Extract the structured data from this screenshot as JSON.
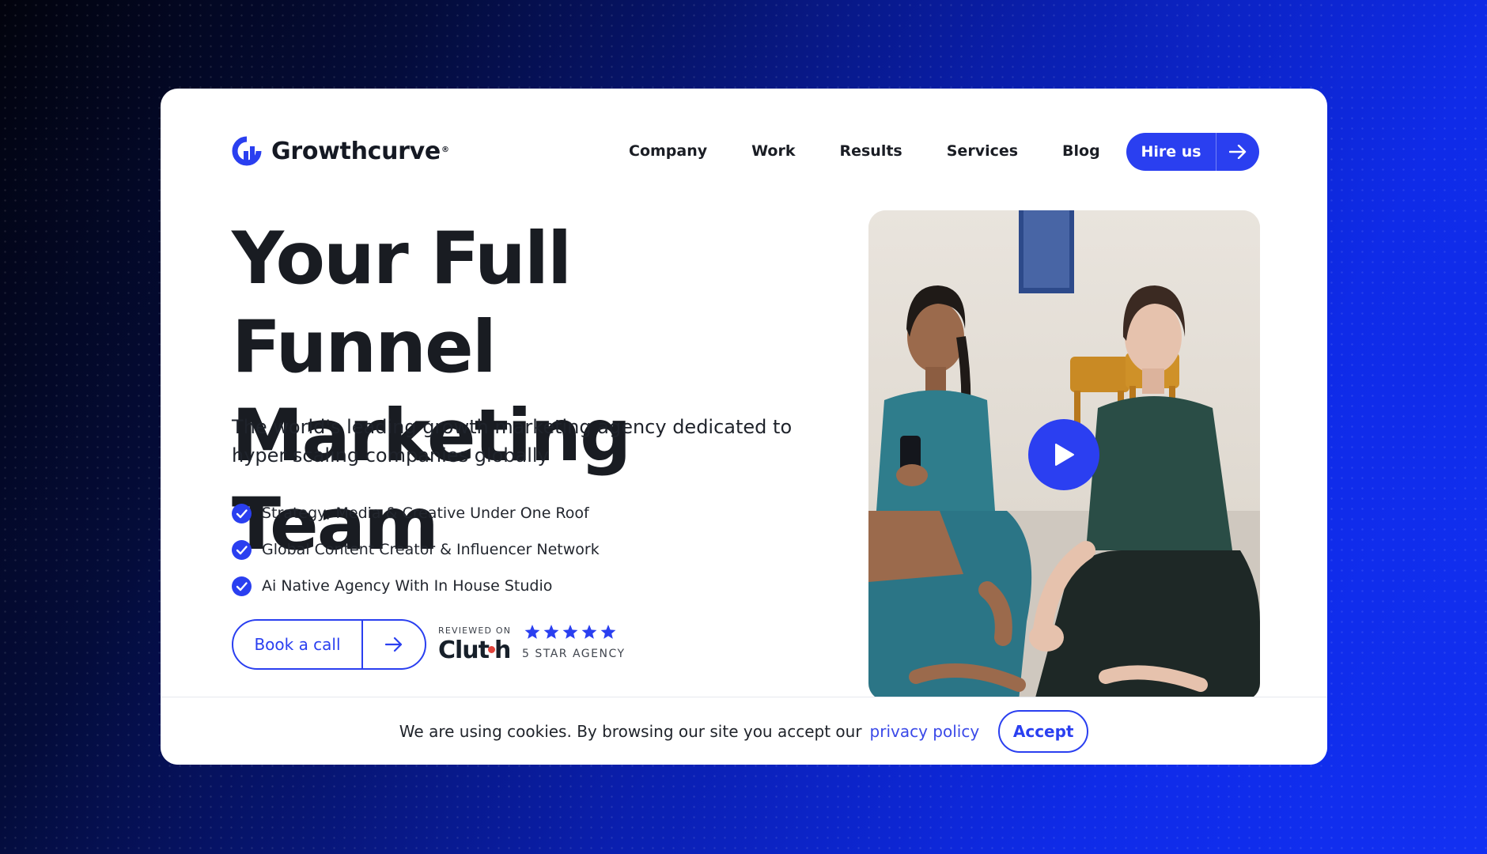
{
  "brand": {
    "name": "Growthcurve",
    "reg": "®",
    "color": "#2a3ff0"
  },
  "nav": {
    "items": [
      "Company",
      "Work",
      "Results",
      "Services",
      "Blog"
    ]
  },
  "header": {
    "cta_label": "Hire us",
    "cta_icon": "arrow-right-icon"
  },
  "hero": {
    "headline_line1": "Your Full Funnel",
    "headline_line2": "Marketing Team",
    "subheadline": "The world's leading growth marketing agency dedicated to hyper scaling companies globally",
    "features": [
      "Strategy, Media & Creative Under One Roof",
      "Global Content Creator & Influencer Network",
      "Ai Native Agency With In House Studio"
    ],
    "book_label": "Book a call",
    "book_icon": "arrow-right-icon"
  },
  "clutch": {
    "reviewed_on": "REVIEWED ON",
    "logo_text_a": "Clut",
    "logo_text_b": "h",
    "rating_stars": 5,
    "agency_label": "5 STAR AGENCY"
  },
  "video": {
    "play_icon": "play-icon"
  },
  "cookie": {
    "text": "We are using cookies. By browsing our site you accept our",
    "link_text": "privacy policy",
    "accept_label": "Accept"
  }
}
